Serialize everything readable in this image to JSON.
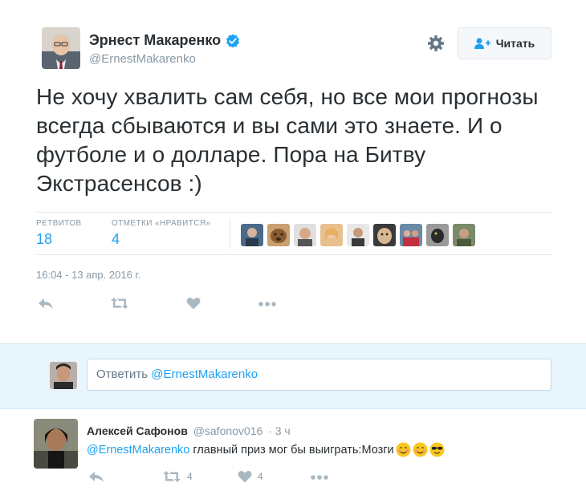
{
  "tweet": {
    "author_name": "Эрнест Макаренко",
    "author_handle": "@ErnestMakarenko",
    "follow_label": "Читать",
    "text": "Не хочу хвалить сам себя, но все мои прогнозы всегда сбываются и вы сами это знаете. И о футболе и о долларе. Пора на Битву Экстрасенсов :)",
    "stats": {
      "retweets_label": "РЕТВИТОВ",
      "retweets_value": "18",
      "likes_label": "ОТМЕТКИ «НРАВИТСЯ»",
      "likes_value": "4"
    },
    "timestamp": "16:04 - 13 апр. 2016 г.",
    "icons": [
      "reply-icon",
      "retweet-icon",
      "heart-icon",
      "more-icon"
    ]
  },
  "reply_box": {
    "prefix": "Ответить ",
    "mention": "@ErnestMakarenko"
  },
  "reply_tweet": {
    "author_name": "Алексей Сафонов",
    "author_handle": "@safonov016",
    "time": "· 3 ч",
    "mention": "@ErnestMakarenko",
    "text": "главный приз мог бы выиграть:Мозги",
    "retweets": "4",
    "likes": "4"
  },
  "colors": {
    "accent": "#1da1f2",
    "muted": "#8899a6",
    "text": "#292f33",
    "reply_bg": "#e8f5fd"
  }
}
